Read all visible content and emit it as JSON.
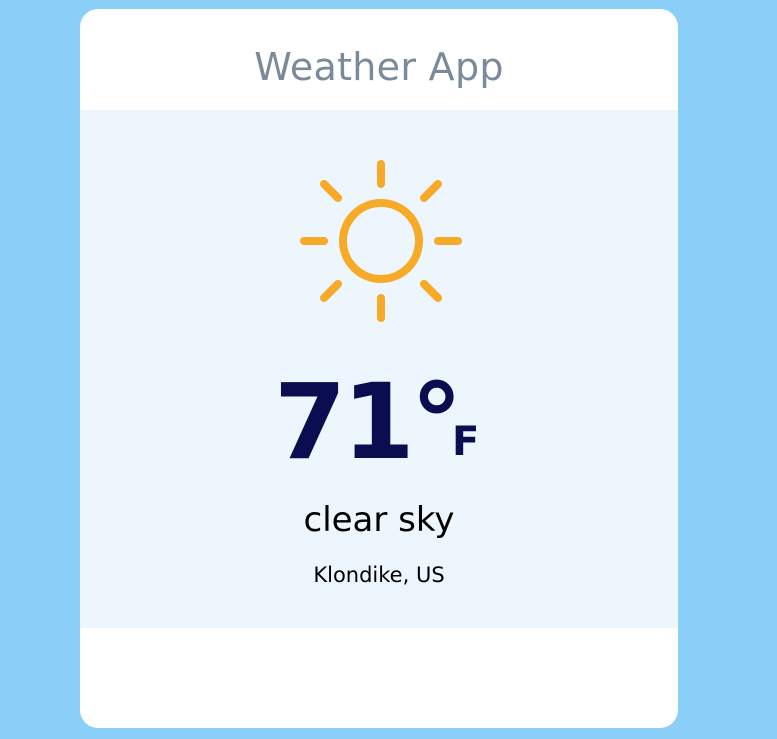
{
  "app": {
    "title": "Weather App"
  },
  "weather": {
    "icon": "sun-icon",
    "temperature": "71°",
    "unit": "F",
    "description": "clear sky",
    "location": "Klondike, US"
  },
  "colors": {
    "background": "#89cff8",
    "card": "#ffffff",
    "panel": "#eef6fd",
    "title": "#7b8a9b",
    "temperature": "#0a0d4f",
    "sun": "#f7a928"
  }
}
